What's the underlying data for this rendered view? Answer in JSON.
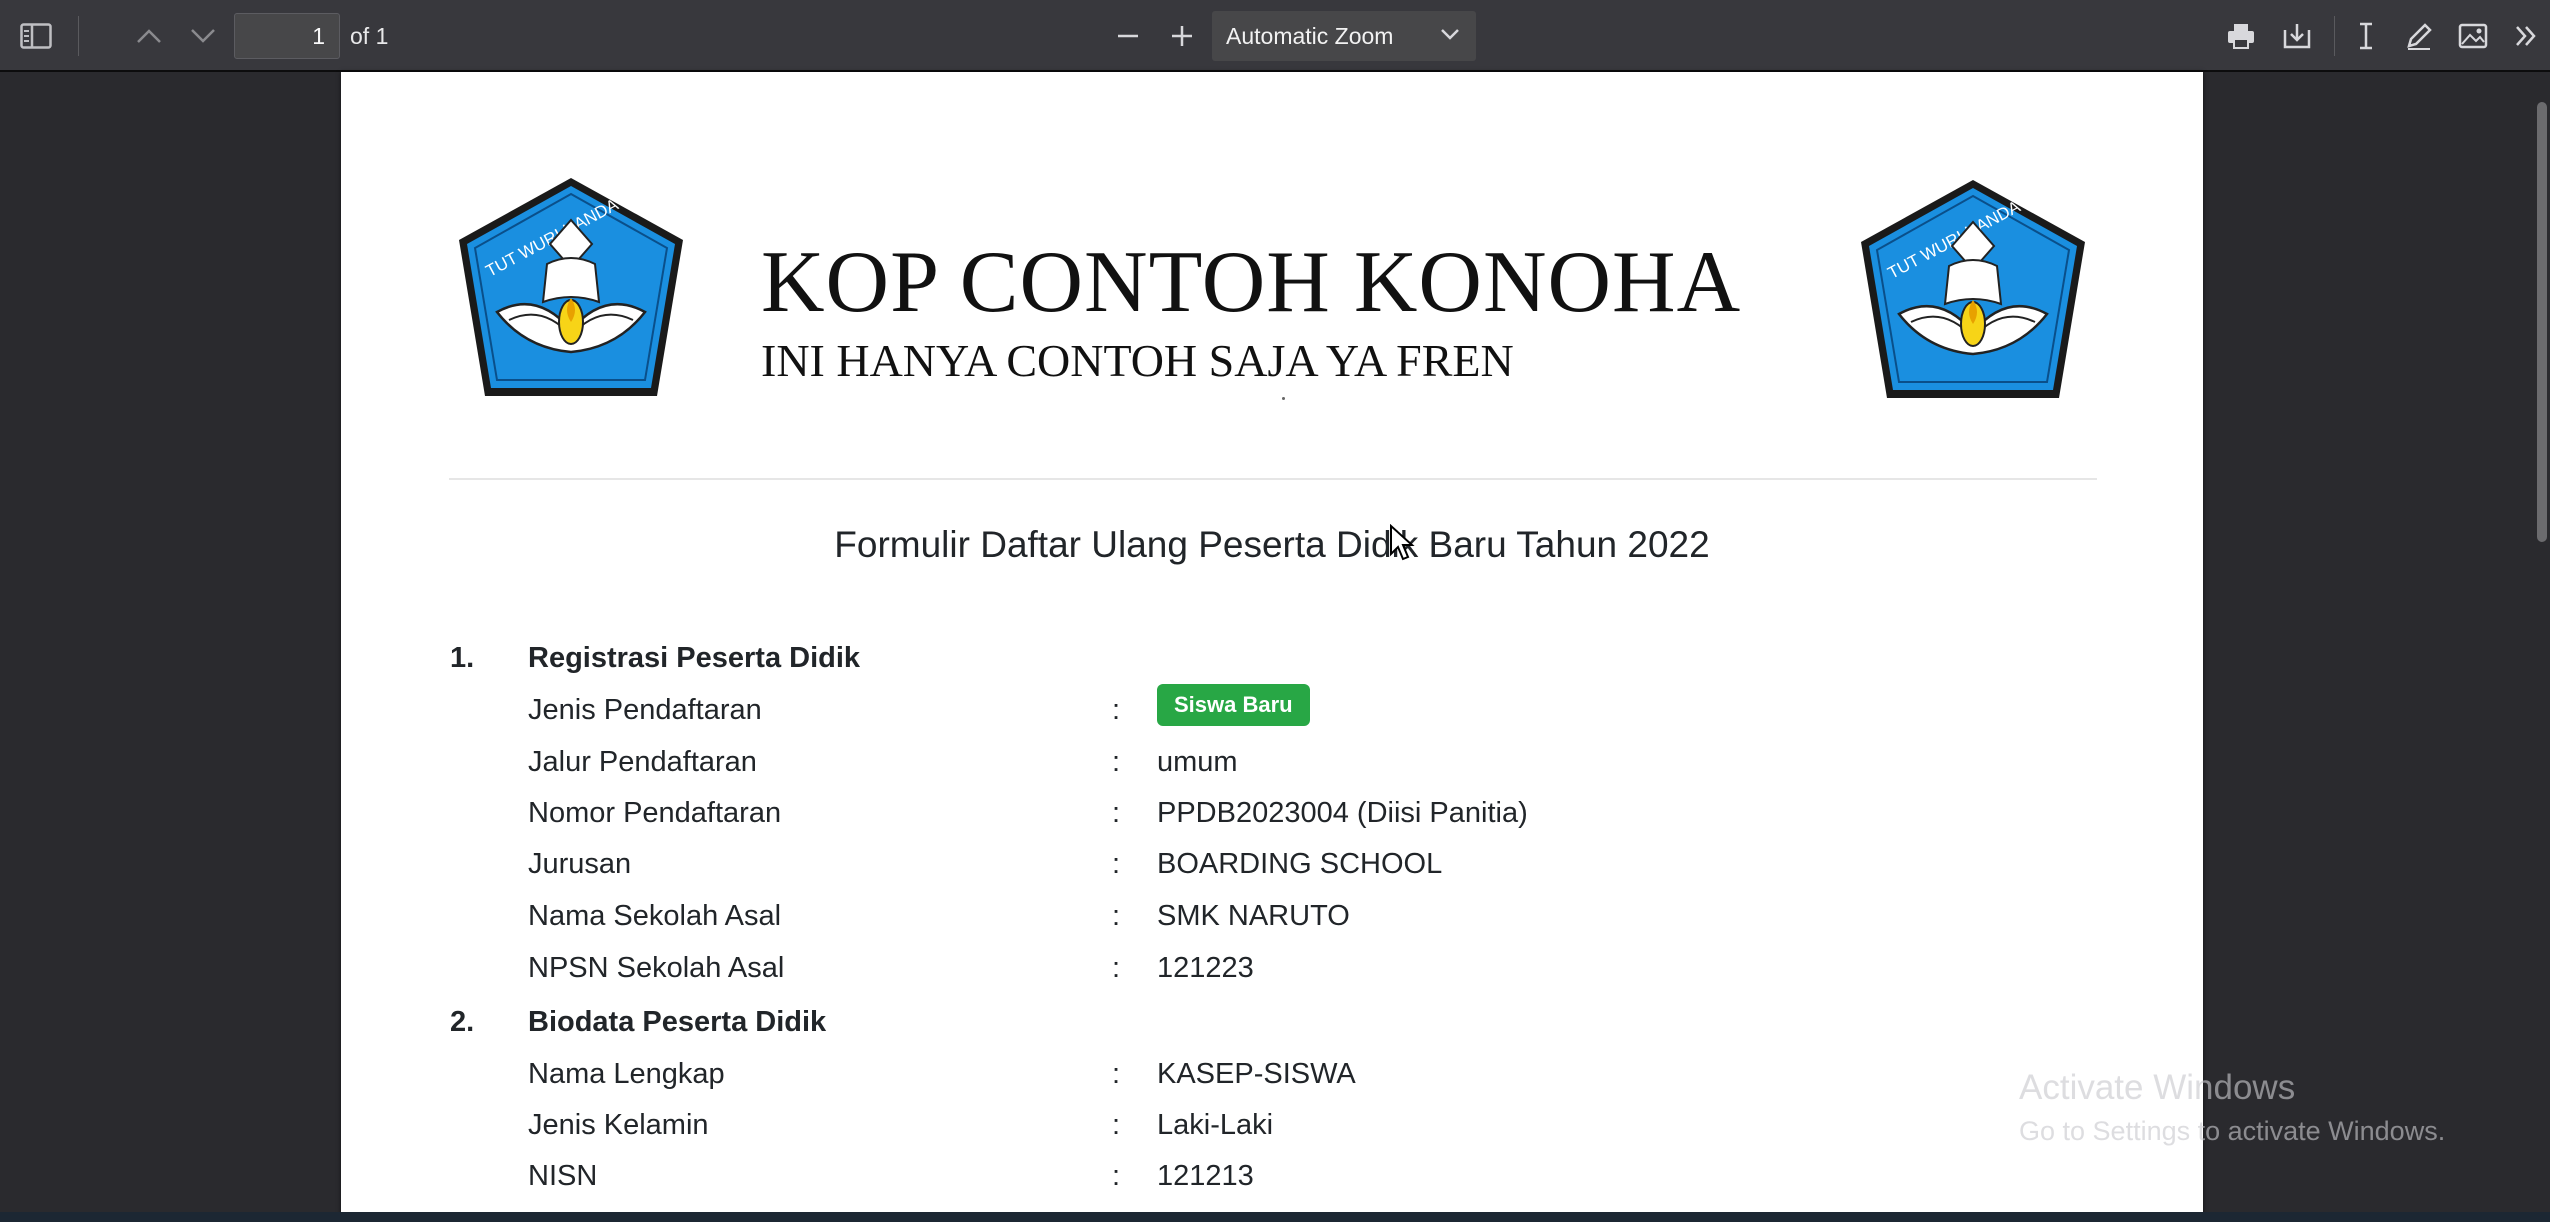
{
  "toolbar": {
    "page_number": "1",
    "page_count_label": "of 1",
    "zoom_value": "Automatic Zoom"
  },
  "document": {
    "kop_title": "KOP CONTOH KONOHA",
    "kop_subtitle": "INI HANYA CONTOH SAJA YA FREN",
    "logo_text": "TUT WURI HANDAYANI",
    "form_title": "Formulir Daftar Ulang Peserta Didik Baru Tahun 2022",
    "section1": {
      "number": "1.",
      "title": "Registrasi Peserta Didik",
      "rows": [
        {
          "label": "Jenis Pendaftaran",
          "colon": ":",
          "value": "Siswa Baru"
        },
        {
          "label": "Jalur Pendaftaran",
          "colon": ":",
          "value": "umum"
        },
        {
          "label": "Nomor Pendaftaran",
          "colon": ":",
          "value": "PPDB2023004 (Diisi Panitia)"
        },
        {
          "label": "Jurusan",
          "colon": ":",
          "value": "BOARDING SCHOOL"
        },
        {
          "label": "Nama Sekolah Asal",
          "colon": ":",
          "value": "SMK NARUTO"
        },
        {
          "label": "NPSN Sekolah Asal",
          "colon": ":",
          "value": "121223"
        }
      ]
    },
    "section2": {
      "number": "2.",
      "title": "Biodata Peserta Didik",
      "rows": [
        {
          "label": "Nama Lengkap",
          "colon": ":",
          "value": "KASEP-SISWA"
        },
        {
          "label": "Jenis Kelamin",
          "colon": ":",
          "value": "Laki-Laki"
        },
        {
          "label": "NISN",
          "colon": ":",
          "value": "121213"
        }
      ]
    }
  },
  "watermark": {
    "line1": "Activate Windows",
    "line2": "Go to Settings to activate Windows."
  },
  "colors": {
    "toolbar_bg": "#38383d",
    "viewer_bg": "#2a2a2e",
    "badge_green": "#28a745",
    "logo_blue": "#1a8fe0"
  }
}
